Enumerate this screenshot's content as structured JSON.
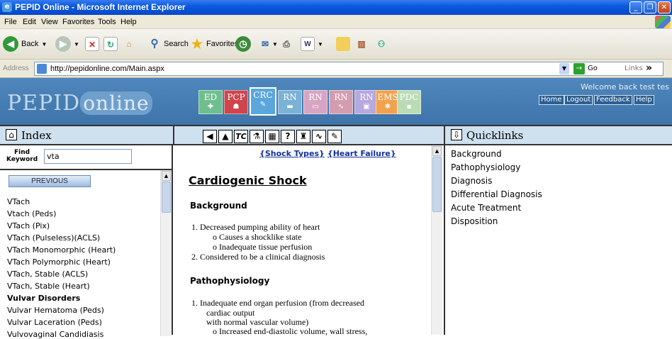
{
  "window": {
    "title": "PEPID Online - Microsoft Internet Explorer"
  },
  "menu": [
    "File",
    "Edit",
    "View",
    "Favorites",
    "Tools",
    "Help"
  ],
  "toolbar": {
    "back_label": "Back",
    "search_label": "Search",
    "favorites_label": "Favorites"
  },
  "address": {
    "label": "Address",
    "url": "http://pepidonline.com/Main.aspx",
    "go_label": "Go",
    "links_label": "Links"
  },
  "header": {
    "logo_a": "PEPID",
    "logo_b": "online",
    "welcome": "Welcome back test tes",
    "nav": [
      "Home",
      "Logout",
      "Feedback",
      "Help"
    ],
    "modules": [
      {
        "label": "ED",
        "color": "#6fbf8e"
      },
      {
        "label": "PCP",
        "color": "#d0444b"
      },
      {
        "label": "CRC",
        "color": "#5aa6dd"
      },
      {
        "label": "RN",
        "color": "#7ab2d4"
      },
      {
        "label": "RN",
        "color": "#d7a5c3"
      },
      {
        "label": "RN",
        "color": "#d39db0"
      },
      {
        "label": "RN",
        "color": "#b7a8df"
      },
      {
        "label": "EMS",
        "color": "#f2a24e"
      },
      {
        "label": "PDC",
        "color": "#b9dcb5"
      }
    ]
  },
  "index": {
    "title": "Index",
    "find_label_1": "Find",
    "find_label_2": "Keyword",
    "keyword": "vta",
    "previous_label": "PREVIOUS",
    "items": [
      {
        "text": "VTach",
        "bold": false
      },
      {
        "text": "Vtach (Peds)",
        "bold": false
      },
      {
        "text": "VTach (Pix)",
        "bold": false
      },
      {
        "text": "VTach (Pulseless)(ACLS)",
        "bold": false
      },
      {
        "text": "VTach Monomorphic (Heart)",
        "bold": false
      },
      {
        "text": "VTach Polymorphic (Heart)",
        "bold": false
      },
      {
        "text": "VTach, Stable (ACLS)",
        "bold": false
      },
      {
        "text": "VTach, Stable (Heart)",
        "bold": false
      },
      {
        "text": "Vulvar Disorders",
        "bold": true
      },
      {
        "text": "Vulvar Hematoma (Peds)",
        "bold": false
      },
      {
        "text": "Vulvar Laceration (Peds)",
        "bold": false
      },
      {
        "text": "Vulvovaginal Candidiasis",
        "bold": false
      }
    ]
  },
  "content": {
    "toolbar_icons": [
      "back-arrow",
      "up-arrow",
      "tc",
      "flask",
      "calculator",
      "question",
      "drug",
      "ekg",
      "pencil"
    ],
    "tc_label": "TC",
    "link_shock_types": "{Shock Types}",
    "link_heart_failure": "{Heart Failure}",
    "title": "Cardiogenic Shock",
    "background_heading": "Background",
    "bg_1": "1.  Decreased pumping ability of heart",
    "bg_1a": "o  Causes a shocklike state",
    "bg_1b": "o  Inadequate tissue perfusion",
    "bg_2": "2.  Considered to be a clinical diagnosis",
    "patho_heading": "Pathophysiology",
    "pa_1": "1.  Inadequate end organ perfusion (from decreased",
    "pa_1_cont1": "cardiac output",
    "pa_1_cont2": "with normal vascular volume)",
    "pa_1a": "o  Increased end-diastolic volume, wall stress,"
  },
  "quicklinks": {
    "title": "Quicklinks",
    "items": [
      "Background",
      "Pathophysiology",
      "Diagnosis",
      "Differential Diagnosis",
      "Acute Treatment",
      "Disposition"
    ]
  }
}
